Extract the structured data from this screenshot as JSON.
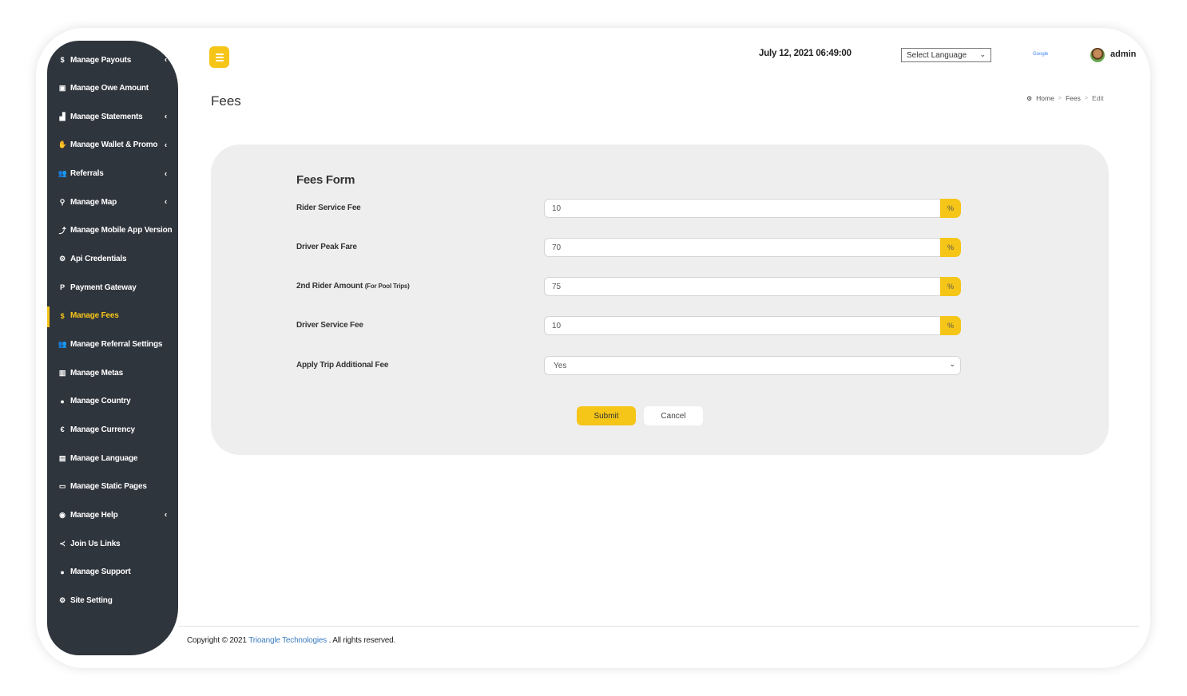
{
  "header": {
    "menu_icon": "hamburger-icon",
    "datetime": "July 12, 2021 06:49:00",
    "language_select": "Select Language",
    "google_label": "Google",
    "user_name": "admin"
  },
  "page": {
    "title": "Fees",
    "breadcrumb": [
      "Home",
      "Fees",
      "Edit"
    ]
  },
  "sidebar": {
    "items": [
      {
        "label": "Manage Payouts",
        "icon": "$",
        "icon_name": "dollar-icon",
        "has_submenu": true
      },
      {
        "label": "Manage Owe Amount",
        "icon": "▣",
        "icon_name": "money-icon",
        "has_submenu": false
      },
      {
        "label": "Manage Statements",
        "icon": "▟",
        "icon_name": "area-chart-icon",
        "has_submenu": true
      },
      {
        "label": "Manage Wallet & Promo",
        "icon": "✋",
        "icon_name": "wallet-icon",
        "has_submenu": true
      },
      {
        "label": "Referrals",
        "icon": "👥",
        "icon_name": "users-icon",
        "has_submenu": true
      },
      {
        "label": "Manage Map",
        "icon": "⚲",
        "icon_name": "map-marker-icon",
        "has_submenu": true
      },
      {
        "label": "Manage Mobile App Version",
        "icon": "⤴",
        "icon_name": "upload-icon",
        "has_submenu": false
      },
      {
        "label": "Api Credentials",
        "icon": "⚙",
        "icon_name": "gear-icon",
        "has_submenu": false
      },
      {
        "label": "Payment Gateway",
        "icon": "P",
        "icon_name": "paypal-icon",
        "has_submenu": false
      },
      {
        "label": "Manage Fees",
        "icon": "$",
        "icon_name": "dollar-icon",
        "has_submenu": false,
        "active": true
      },
      {
        "label": "Manage Referral Settings",
        "icon": "👥",
        "icon_name": "users-icon",
        "has_submenu": false
      },
      {
        "label": "Manage Metas",
        "icon": "▥",
        "icon_name": "bar-chart-icon",
        "has_submenu": false
      },
      {
        "label": "Manage Country",
        "icon": "●",
        "icon_name": "globe-icon",
        "has_submenu": false
      },
      {
        "label": "Manage Currency",
        "icon": "€",
        "icon_name": "euro-icon",
        "has_submenu": false
      },
      {
        "label": "Manage Language",
        "icon": "▤",
        "icon_name": "language-icon",
        "has_submenu": false
      },
      {
        "label": "Manage Static Pages",
        "icon": "▭",
        "icon_name": "newspaper-icon",
        "has_submenu": false
      },
      {
        "label": "Manage Help",
        "icon": "◉",
        "icon_name": "life-ring-icon",
        "has_submenu": true
      },
      {
        "label": "Join Us Links",
        "icon": "≺",
        "icon_name": "share-icon",
        "has_submenu": false
      },
      {
        "label": "Manage Support",
        "icon": "●",
        "icon_name": "globe-icon",
        "has_submenu": false
      },
      {
        "label": "Site Setting",
        "icon": "⚙",
        "icon_name": "gears-icon",
        "has_submenu": false
      }
    ]
  },
  "form": {
    "title": "Fees Form",
    "fields": [
      {
        "label": "Rider Service Fee",
        "sub": "",
        "value": "10",
        "addon": "%"
      },
      {
        "label": "Driver Peak Fare",
        "sub": "",
        "value": "70",
        "addon": "%"
      },
      {
        "label": "2nd Rider Amount",
        "sub": "(For Pool Trips)",
        "value": "75",
        "addon": "%"
      },
      {
        "label": "Driver Service Fee",
        "sub": "",
        "value": "10",
        "addon": "%"
      }
    ],
    "apply_fee": {
      "label": "Apply Trip Additional Fee",
      "value": "Yes"
    },
    "submit_label": "Submit",
    "cancel_label": "Cancel"
  },
  "footer": {
    "prefix": "Copyright © 2021",
    "company": "Trioangle Technologies",
    "suffix": ". All rights reserved."
  },
  "colors": {
    "accent": "#f5c518",
    "sidebar_bg": "#2f353d",
    "card_bg": "#eeeeee",
    "link": "#3a7bbf"
  }
}
